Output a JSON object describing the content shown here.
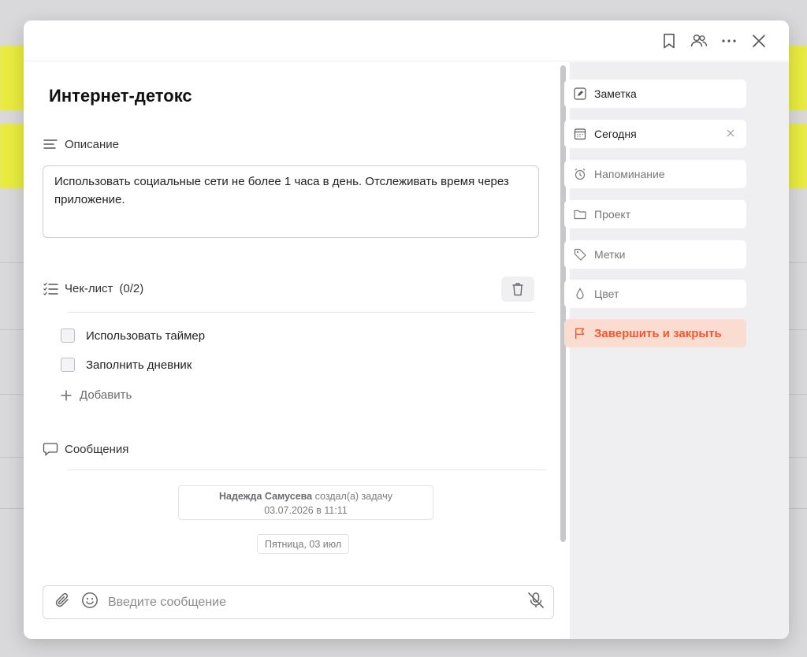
{
  "colors": {
    "accent": "#f0592f",
    "accent_bg": "#fbdcd1",
    "highlight": "#e9ec3e"
  },
  "header": {
    "icons": [
      "bookmark-icon",
      "users-icon",
      "more-icon",
      "close-icon"
    ]
  },
  "task": {
    "title": "Интернет-детокс"
  },
  "description": {
    "label": "Описание",
    "text": "Использовать социальные сети не более 1 часа в день. Отслеживать время через приложение."
  },
  "checklist": {
    "label": "Чек-лист",
    "count": "(0/2)",
    "items": [
      {
        "label": "Использовать таймер",
        "checked": false
      },
      {
        "label": "Заполнить дневник",
        "checked": false
      }
    ],
    "add_label": "Добавить"
  },
  "messages": {
    "label": "Сообщения",
    "event": {
      "author": "Надежда Самусева",
      "action": "создал(а) задачу",
      "datetime": "03.07.2026 в 11:11"
    },
    "date_chip": "Пятница, 03 июл"
  },
  "composer": {
    "placeholder": "Введите сообщение"
  },
  "sidebar": {
    "items": [
      {
        "label": "Заметка",
        "icon": "pencil-icon"
      },
      {
        "label": "Сегодня",
        "icon": "calendar-icon"
      },
      {
        "label": "Напоминание",
        "icon": "alarm-icon"
      },
      {
        "label": "Проект",
        "icon": "folder-icon"
      },
      {
        "label": "Метки",
        "icon": "tag-icon"
      },
      {
        "label": "Цвет",
        "icon": "drop-icon"
      }
    ],
    "finish_label": "Завершить и закрыть"
  }
}
